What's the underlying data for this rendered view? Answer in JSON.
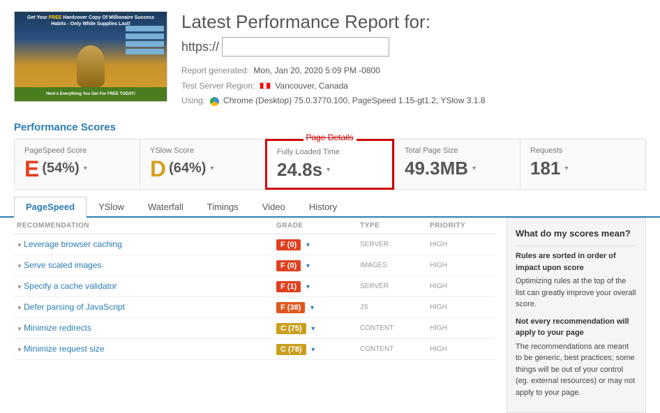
{
  "header": {
    "title": "Latest Performance Report for:",
    "url_prefix": "https://",
    "url_placeholder": "",
    "report_generated_label": "Report generated:",
    "report_generated_value": "Mon, Jan 20, 2020 5:09 PM -0800",
    "test_server_label": "Test Server Region:",
    "test_server_value": "Vancouver, Canada",
    "using_label": "Using:",
    "using_value": "Chrome (Desktop) 75.0.3770.100, PageSpeed 1.15-gt1.2, YSlow 3.1.8"
  },
  "performance_scores": {
    "title": "Performance Scores",
    "page_details_label": "Page Details",
    "pagespeed": {
      "label": "PageSpeed Score",
      "letter": "E",
      "percent": "(54%)",
      "grade_class": "grade-e"
    },
    "yslow": {
      "label": "YSlow Score",
      "letter": "D",
      "percent": "(64%)",
      "grade_class": "grade-d"
    },
    "fully_loaded": {
      "label": "Fully Loaded Time",
      "value": "24.8s"
    },
    "total_page_size": {
      "label": "Total Page Size",
      "value": "49.3MB"
    },
    "requests": {
      "label": "Requests",
      "value": "181"
    }
  },
  "tabs": [
    {
      "label": "PageSpeed",
      "active": true
    },
    {
      "label": "YSlow",
      "active": false
    },
    {
      "label": "Waterfall",
      "active": false
    },
    {
      "label": "Timings",
      "active": false
    },
    {
      "label": "Video",
      "active": false
    },
    {
      "label": "History",
      "active": false
    }
  ],
  "table": {
    "headers": {
      "recommendation": "RECOMMENDATION",
      "grade": "GRADE",
      "type": "TYPE",
      "priority": "PRIORITY"
    },
    "rows": [
      {
        "name": "Leverage browser caching",
        "grade": "F (0)",
        "grade_type": "f",
        "type": "SERVER",
        "priority": "HIGH"
      },
      {
        "name": "Serve scaled images",
        "grade": "F (0)",
        "grade_type": "f",
        "type": "IMAGES",
        "priority": "HIGH"
      },
      {
        "name": "Specify a cache validator",
        "grade": "F (1)",
        "grade_type": "f",
        "type": "SERVER",
        "priority": "HIGH"
      },
      {
        "name": "Defer parsing of JavaScript",
        "grade": "F (38)",
        "grade_type": "f-orange",
        "type": "JS",
        "priority": "HIGH"
      },
      {
        "name": "Minimize redirects",
        "grade": "C (75)",
        "grade_type": "c",
        "type": "CONTENT",
        "priority": "HIGH"
      },
      {
        "name": "Minimize request size",
        "grade": "C (78)",
        "grade_type": "c",
        "type": "CONTENT",
        "priority": "HIGH"
      }
    ]
  },
  "side_panel": {
    "title": "What do my scores mean?",
    "section1_heading": "Rules are sorted in order of impact upon score",
    "section1_text": "Optimizing rules at the top of the list can greatly improve your overall score.",
    "section2_heading": "Not every recommendation will apply to your page",
    "section2_text": "The recommendations are meant to be generic, best practices; some things will be out of your control (eg. external resources) or may not apply to your page."
  }
}
